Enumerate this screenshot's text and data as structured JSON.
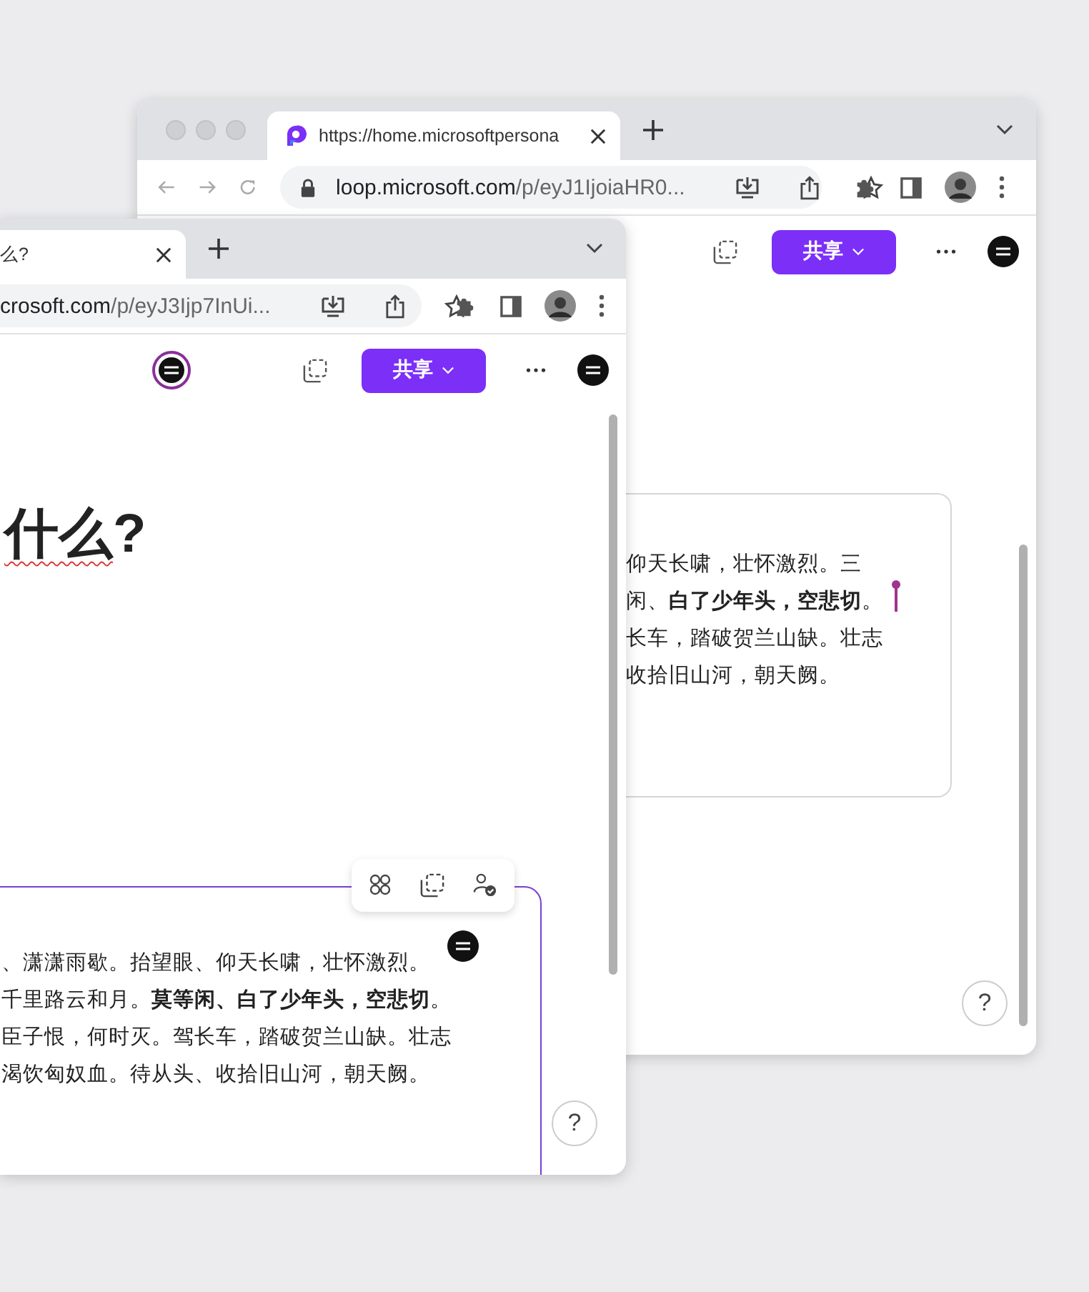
{
  "windows": [
    {
      "kind": "back",
      "tab": {
        "title": "https://home.microsoftpersona",
        "selected": true
      },
      "address": {
        "domain": "loop.microsoft.com",
        "path": "/p/eyJ1IjoiaHR0..."
      },
      "share_button": "共享",
      "card": {
        "selected": false,
        "lines": [
          {
            "text": "仰天长啸，壮怀激烈。三"
          },
          {
            "text": "闲、**白了少年头，空悲切**。"
          },
          {
            "text": "长车，踏破贺兰山缺。壮志"
          },
          {
            "text": "收拾旧山河，朝天阙。"
          }
        ]
      },
      "help_button": "?"
    },
    {
      "kind": "front",
      "tab": {
        "title": "么?",
        "selected": true
      },
      "address": {
        "domain": "crosoft.com",
        "path": "/p/eyJ3Ijp7InUi..."
      },
      "share_button": "共享",
      "collaborator_in_header": true,
      "heading": [
        {
          "text": "什么",
          "spell_error": true
        },
        {
          "text": "?",
          "spell_error": false
        }
      ],
      "card": {
        "selected": true,
        "lines": [
          {
            "text": "、潇潇雨歇。抬望眼、仰天长啸，壮怀激烈。"
          },
          {
            "text": "千里路云和月。**莫等闲、白了少年头，空悲切**。"
          },
          {
            "text": "臣子恨，何时灭。驾长车，踏破贺兰山缺。壮志"
          },
          {
            "text": "渴饮匈奴血。待从头、收拾旧山河，朝天阙。"
          }
        ]
      },
      "help_button": "?"
    }
  ]
}
